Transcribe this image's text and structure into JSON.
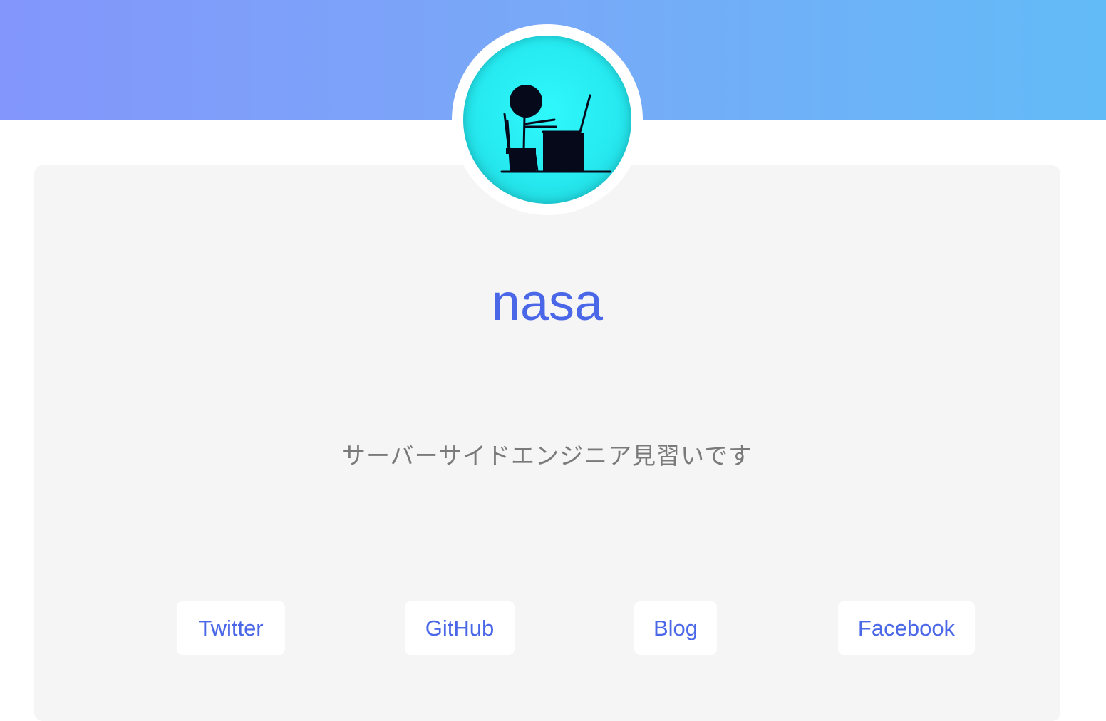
{
  "profile": {
    "name": "nasa",
    "bio": "サーバーサイドエンジニア見習いです",
    "avatar_icon": "person-at-laptop-icon"
  },
  "links": [
    {
      "label": "Twitter"
    },
    {
      "label": "GitHub"
    },
    {
      "label": "Blog"
    },
    {
      "label": "Facebook"
    }
  ],
  "colors": {
    "header_gradient_start": "#8396fb",
    "header_gradient_end": "#62bbf7",
    "accent": "#4a67e8",
    "card_background": "#f5f5f5",
    "bio_text": "#7a7a7a",
    "avatar_background": "#2ff8fb"
  }
}
